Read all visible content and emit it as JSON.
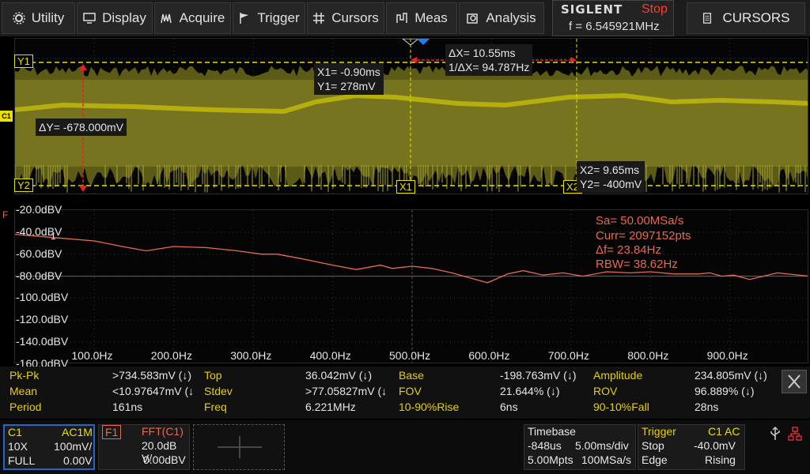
{
  "menu": {
    "items": [
      {
        "label": "Utility",
        "icon": "gear-icon"
      },
      {
        "label": "Display",
        "icon": "monitor-icon"
      },
      {
        "label": "Acquire",
        "icon": "acquire-icon"
      },
      {
        "label": "Trigger",
        "icon": "flag-icon"
      },
      {
        "label": "Cursors",
        "icon": "crosshair-icon"
      },
      {
        "label": "Meas",
        "icon": "ruler-icon"
      },
      {
        "label": "Analysis",
        "icon": "magnify-icon"
      }
    ],
    "brand": "SIGLENT",
    "run_state": "Stop",
    "frequency": "f = 6.545921MHz",
    "cursors_label": "CURSORS"
  },
  "cursors": {
    "y1_tag": "Y1",
    "y2_tag": "Y2",
    "x1_tag": "X1",
    "x2_tag": "X2",
    "delta_x": "ΔX= 10.55ms",
    "inv_delta_x": "1/ΔX= 94.787Hz",
    "x1": "X1= -0.90ms",
    "y1": "Y1= 278mV",
    "x2": "X2= 9.65ms",
    "y2": "Y2= -400mV",
    "delta_y": "ΔY= -678.000mV",
    "channel_marker": "C1"
  },
  "fft": {
    "marker": "F",
    "y_labels": [
      "-20.0dBV",
      "-40.0dBV",
      "-60.0dBV",
      "-80.0dBV",
      "-100.0dBV",
      "-120.0dBV",
      "-140.0dBV",
      "-160.0dBV"
    ],
    "x_labels": [
      "100.0Hz",
      "200.0Hz",
      "300.0Hz",
      "400.0Hz",
      "500.0Hz",
      "600.0Hz",
      "700.0Hz",
      "800.0Hz",
      "900.0Hz"
    ],
    "info": [
      "Sa= 50.00MSa/s",
      "Curr= 2097152pts",
      "Δf= 23.84Hz",
      "RBW= 38.62Hz"
    ],
    "cursor_marker": "1"
  },
  "chart_data": {
    "type": "line",
    "title": "",
    "xlabel": "",
    "ylabel": "",
    "x_unit": "Hz",
    "y_unit": "dBV",
    "xlim": [
      0,
      1000
    ],
    "ylim": [
      -160,
      -20
    ],
    "series": [
      {
        "x": [
          0,
          50,
          100,
          135,
          165,
          200,
          240,
          280,
          310,
          330,
          360,
          400,
          430,
          460,
          475,
          500,
          525,
          550,
          575,
          595,
          620,
          640,
          665,
          690,
          715,
          745,
          775,
          800,
          830,
          860,
          875,
          890,
          905,
          925,
          960,
          1000
        ],
        "values": [
          -42,
          -45,
          -48,
          -53,
          -57,
          -53,
          -54,
          -57,
          -60,
          -60,
          -64,
          -70,
          -74,
          -70,
          -73,
          -71,
          -73,
          -77,
          -82,
          -86,
          -78,
          -75,
          -79,
          -77,
          -80,
          -76,
          -77,
          -76,
          -78,
          -78,
          -77,
          -80,
          -79,
          -83,
          -77,
          -80
        ]
      }
    ]
  },
  "measurements": {
    "rows": [
      [
        {
          "name": "Pk-Pk",
          "value": ">734.583mV (↓)"
        },
        {
          "name": "Top",
          "value": "36.042mV (↓)"
        },
        {
          "name": "Base",
          "value": "-198.763mV (↓)"
        },
        {
          "name": "Amplitude",
          "value": "234.805mV (↓)"
        }
      ],
      [
        {
          "name": "Mean",
          "value": "<10.97647mV (↓"
        },
        {
          "name": "Stdev",
          "value": ">77.05827mV (↓"
        },
        {
          "name": "FOV",
          "value": "21.644% (↓)"
        },
        {
          "name": "ROV",
          "value": "96.889% (↓)"
        }
      ],
      [
        {
          "name": "Period",
          "value": "161ns"
        },
        {
          "name": "Freq",
          "value": "6.221MHz"
        },
        {
          "name": "10-90%Rise",
          "value": "6ns"
        },
        {
          "name": "90-10%Fall",
          "value": "28ns"
        }
      ]
    ]
  },
  "channel1": {
    "name": "C1",
    "coupling": "AC1M",
    "probe": "10X",
    "scale": "100mV/",
    "bandwidth": "FULL",
    "offset": "0.00V"
  },
  "math1": {
    "name": "F1",
    "function": "FFT(C1)",
    "scale": "20.0dB V/",
    "offset": "0.00dBV"
  },
  "timebase": {
    "title": "Timebase",
    "delay": "-848us",
    "scale": "5.00ms/div",
    "memory": "5.00Mpts",
    "sample_rate": "100MSa/s"
  },
  "trigger": {
    "title": "Trigger",
    "source": "C1 AC",
    "mode": "Stop",
    "level": "-40.0mV",
    "type": "Edge",
    "slope": "Rising"
  },
  "colors": {
    "ch1": "#e8e000",
    "fft": "#e86a50",
    "label": "#e8d000",
    "stop": "#ff3b2f",
    "channel_box": "#2266cc"
  }
}
